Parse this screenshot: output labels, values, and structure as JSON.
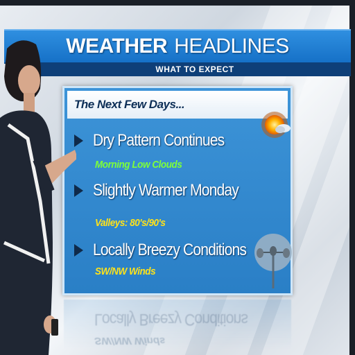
{
  "header": {
    "title_bold": "WEATHER",
    "title_light": "HEADLINES",
    "subtitle": "WHAT TO EXPECT"
  },
  "panel": {
    "heading": "The Next Few Days...",
    "items": [
      {
        "text": "Dry Pattern Continues",
        "detail": "Morning Low Clouds",
        "detail_color": "#7dff3a"
      },
      {
        "text": "Slightly Warmer Monday",
        "detail": "Valleys: 80's/90's",
        "detail_color": "#ffe21a"
      },
      {
        "text": "Locally Breezy Conditions",
        "detail": "SW/NW Winds",
        "detail_color": "#ffe21a"
      }
    ],
    "icons": [
      "sun-cloud-icon",
      "anemometer-icon"
    ]
  },
  "reflection": {
    "line_1": "Locally Breezy Conditions",
    "line_2": "SW/NW Winds"
  },
  "colors": {
    "title_bar": "#1671c7",
    "subtitle_bar": "#0e3f78",
    "panel": "#2a7fc6",
    "detail_green": "#7dff3a",
    "detail_yellow": "#ffe21a"
  }
}
